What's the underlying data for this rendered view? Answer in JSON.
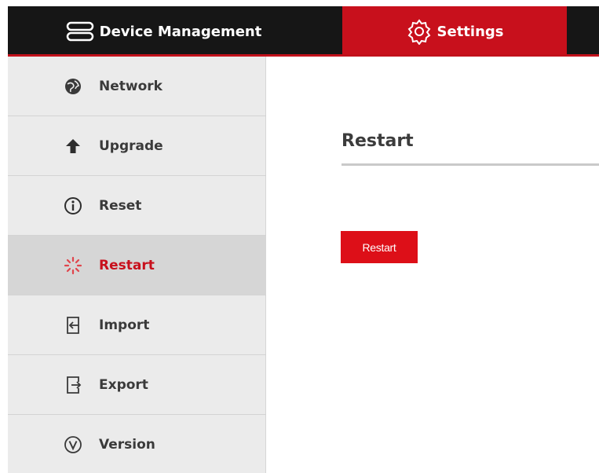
{
  "header": {
    "tabs": [
      {
        "label": "Device Management",
        "icon": "device-stack-icon",
        "active": false
      },
      {
        "label": "Settings",
        "icon": "gear-icon",
        "active": true
      }
    ]
  },
  "sidebar": {
    "items": [
      {
        "label": "Network",
        "icon": "network-globe-icon",
        "active": false
      },
      {
        "label": "Upgrade",
        "icon": "arrow-up-icon",
        "active": false
      },
      {
        "label": "Reset",
        "icon": "info-circle-icon",
        "active": false
      },
      {
        "label": "Restart",
        "icon": "spinner-icon",
        "active": true
      },
      {
        "label": "Import",
        "icon": "import-icon",
        "active": false
      },
      {
        "label": "Export",
        "icon": "export-icon",
        "active": false
      },
      {
        "label": "Version",
        "icon": "version-circle-icon",
        "active": false
      }
    ]
  },
  "main": {
    "title": "Restart",
    "restart_button_label": "Restart"
  },
  "colors": {
    "accent": "#c8101c",
    "topbar": "#161616",
    "sidebar_bg": "#ebebeb",
    "sidebar_active_bg": "#d6d6d6"
  }
}
